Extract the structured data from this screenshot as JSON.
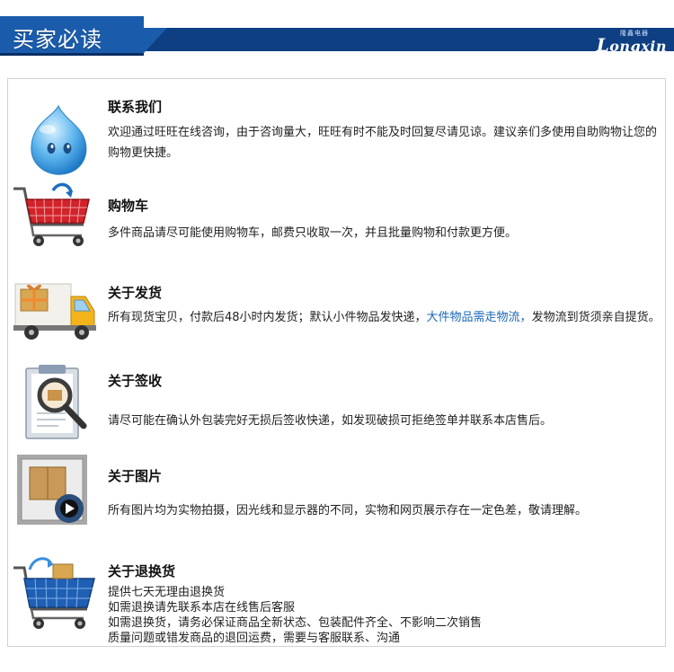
{
  "header": {
    "title": "买家必读",
    "brand_sub": "隆鑫电器",
    "brand_initial": "L",
    "brand_rest": "ongxin"
  },
  "sections": [
    {
      "icon": "wangwang-chat-icon",
      "title": "联系我们",
      "text": "欢迎通过旺旺在线咨询，由于咨询量大，旺旺有时不能及时回复尽请见谅。建议亲们多使用自助购物让您的购物更快捷。"
    },
    {
      "icon": "shopping-cart-icon",
      "title": "购物车",
      "text": "多件商品请尽可能使用购物车，邮费只收取一次，并且批量购物和付款更方便。"
    },
    {
      "icon": "delivery-truck-icon",
      "title": "关于发货",
      "text_before": "所有现货宝贝，付款后48小时内发货；默认小件物品发快递，",
      "text_highlight": "大件物品需走物流，",
      "text_after": "发物流到货须亲自提货。"
    },
    {
      "icon": "sign-inspect-icon",
      "title": "关于签收",
      "text": "请尽可能在确认外包装完好无损后签收快递，如发现破损可拒绝签单并联系本店售后。"
    },
    {
      "icon": "photo-frame-icon",
      "title": "关于图片",
      "text": "所有图片均为实物拍摄，因光线和显示器的不同，实物和网页展示存在一定色差，敬请理解。"
    },
    {
      "icon": "return-cart-icon",
      "title": "关于退换货",
      "lines": [
        "提供七天无理由退换货",
        "如需退换请先联系本店在线售后客服",
        "如需退换货，请务必保证商品全新状态、包装配件齐全、不影响二次销售",
        "质量问题或错发商品的退回运费，需要与客服联系、沟通"
      ]
    }
  ],
  "colors": {
    "banner_dark": "#0e3f82",
    "banner_tab": "#1a5cab",
    "highlight": "#1a65b8",
    "panel_border": "#d2d2d2"
  }
}
